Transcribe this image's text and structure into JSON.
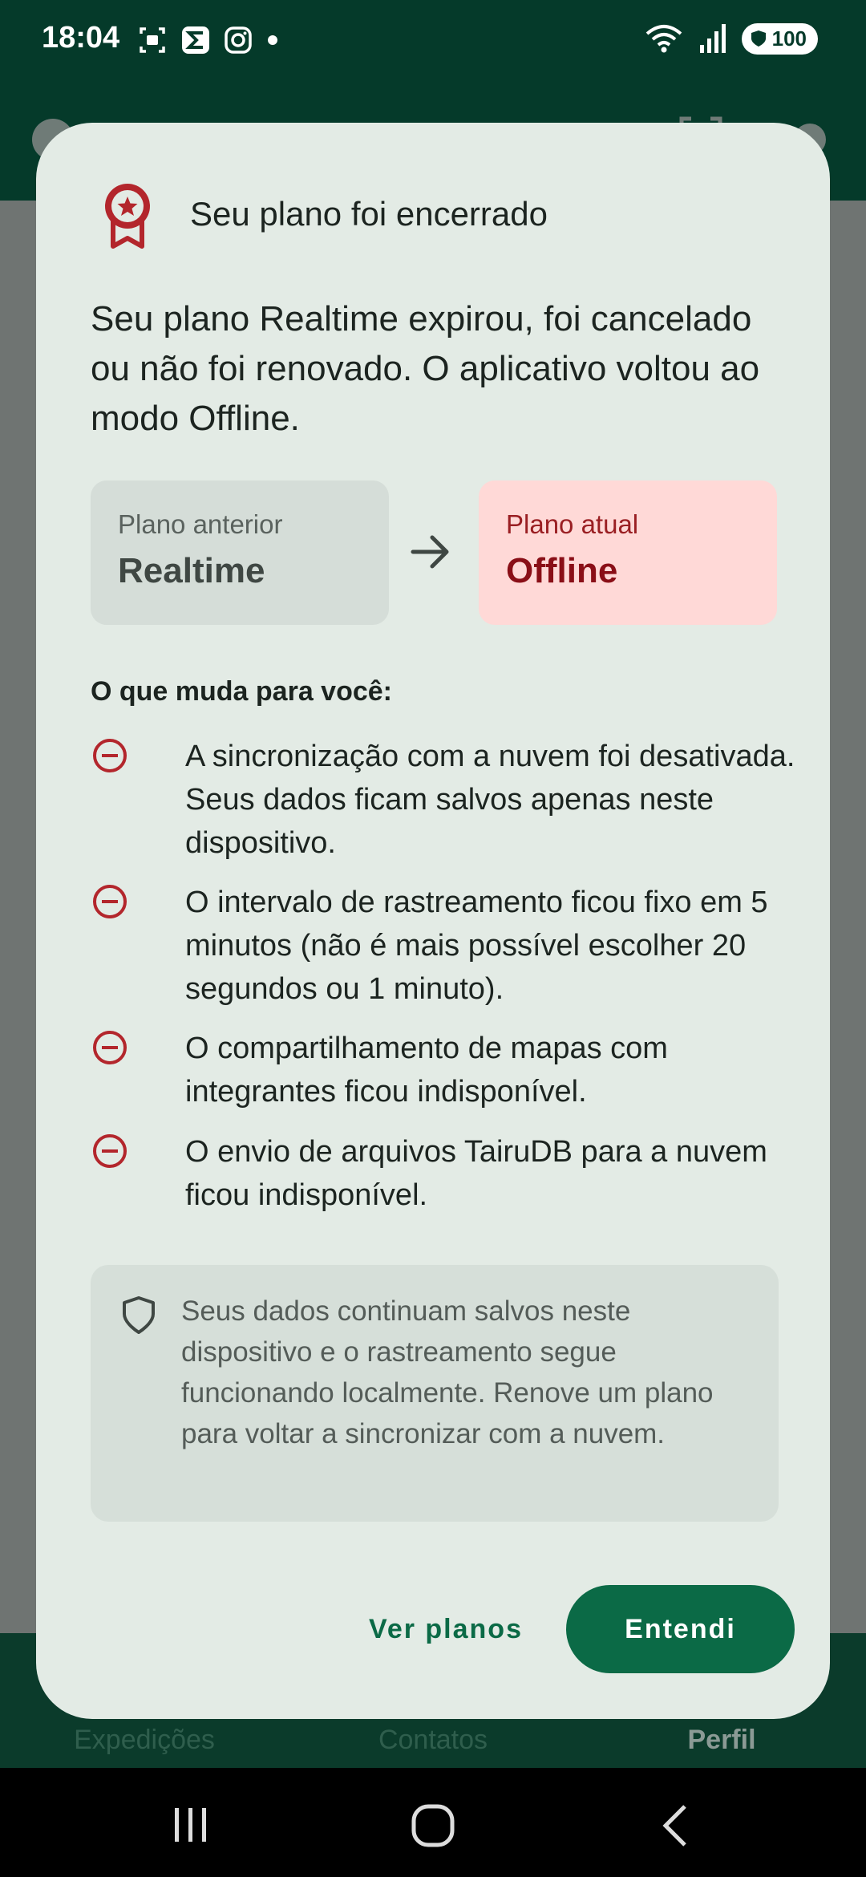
{
  "status_bar": {
    "time": "18:04",
    "battery": "100",
    "icons_left": [
      "screenshot-icon",
      "sigma-app-icon",
      "instagram-icon",
      "dot-icon"
    ],
    "icons_right": [
      "wifi-icon",
      "signal-icon",
      "battery-icon"
    ]
  },
  "bottom_nav": {
    "items": [
      {
        "label": "Expedições",
        "active": false
      },
      {
        "label": "Contatos",
        "active": false
      },
      {
        "label": "Perfil",
        "active": true
      }
    ]
  },
  "dialog": {
    "title": "Seu plano foi encerrado",
    "icon": "award-badge-icon",
    "body": "Seu plano Realtime expirou, foi cancelado ou não foi renovado. O aplicativo voltou ao modo Offline.",
    "previous_plan": {
      "label": "Plano anterior",
      "value": "Realtime"
    },
    "current_plan": {
      "label": "Plano atual",
      "value": "Offline"
    },
    "changes_heading": "O que muda para você:",
    "changes": [
      "A sincronização com a nuvem foi desativada. Seus dados ficam salvos apenas neste dispositivo.",
      "O intervalo de rastreamento ficou fixo em 5 minutos (não é mais possível escolher 20 segundos ou 1 minuto).",
      "O compartilhamento de mapas com integrantes ficou indisponível.",
      "O envio de arquivos TairuDB para a nuvem ficou indisponível."
    ],
    "info": "Seus dados continuam salvos neste dispositivo e o rastreamento segue funcionando localmente. Renove um plano para voltar a sincronizar com a nuvem.",
    "secondary_button": "Ver planos",
    "primary_button": "Entendi"
  },
  "colors": {
    "app_green": "#053a2a",
    "primary": "#0b6a46",
    "dialog_bg": "#e3ebe5",
    "error": "#b3262c",
    "current_plan_bg": "#ffd9d7"
  }
}
